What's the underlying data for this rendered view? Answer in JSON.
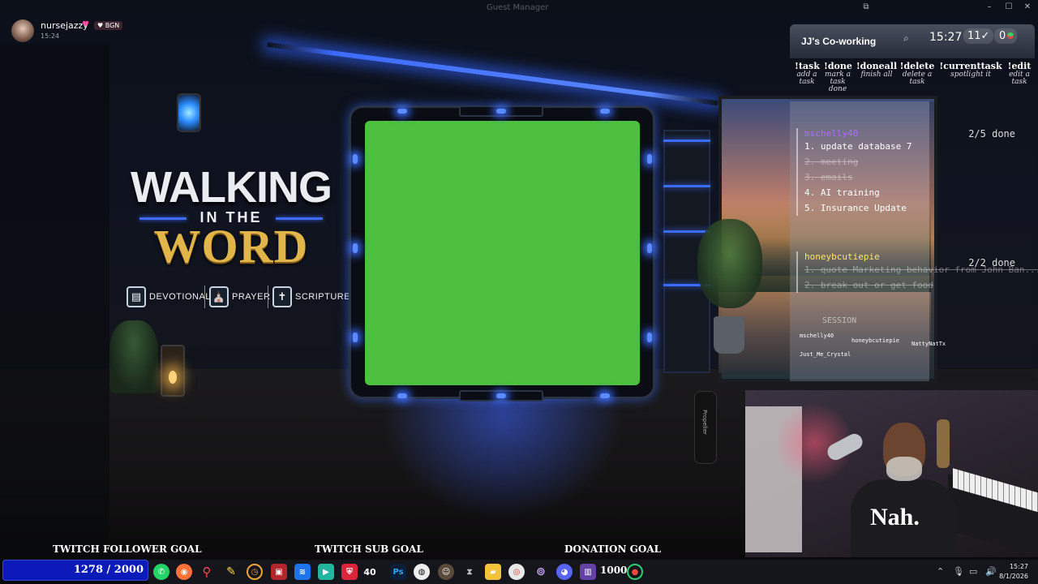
{
  "window": {
    "title": "Guest Manager"
  },
  "user": {
    "name": "nursejazzy",
    "time": "15:24",
    "badge": "BGN"
  },
  "logo": {
    "line1": "WALKING",
    "line2": "IN THE",
    "line3": "WORD",
    "items": [
      {
        "label": "DEVOTIONALS",
        "icon": "book-icon"
      },
      {
        "label": "PRAYER",
        "icon": "praying-hands-icon"
      },
      {
        "label": "SCRIPTURE",
        "icon": "bible-icon"
      }
    ]
  },
  "cowork": {
    "title": "JJ's Co-working",
    "clock": "15:27",
    "count": "11✓",
    "zero": "0",
    "commands": [
      {
        "name": "!task",
        "desc": "add a task"
      },
      {
        "name": "!done",
        "desc": "mark a task done"
      },
      {
        "name": "!doneall",
        "desc": "finish all"
      },
      {
        "name": "!delete",
        "desc": "delete a task"
      },
      {
        "name": "!currenttask",
        "desc": "spotlight it"
      },
      {
        "name": "!edit",
        "desc": "edit a task"
      }
    ],
    "users": [
      {
        "name": "mschelly40",
        "progress": "2/5 done",
        "tasks": [
          {
            "text": "1. update database 7",
            "done": false
          },
          {
            "text": "2. meeting",
            "done": true
          },
          {
            "text": "3. emails",
            "done": true
          },
          {
            "text": "4. AI training",
            "done": false
          },
          {
            "text": "5. Insurance Update",
            "done": false
          }
        ]
      },
      {
        "name": "honeybcutiepie",
        "progress": "2/2 done",
        "tasks": [
          {
            "text": "1. quote Marketing behavior from John Ban...",
            "done": true
          },
          {
            "text": "2. break out or get food",
            "done": true
          }
        ]
      }
    ],
    "session_label": "SESSION",
    "session_names": [
      "mschelly40",
      "honeybcutiepie",
      "NattyNatTx",
      "Just_Me_Crystal"
    ]
  },
  "webcam": {
    "shirt_text": "Nah."
  },
  "scene": {
    "bottle_text": "Propeller"
  },
  "goals": {
    "follower_label": "TWITCH FOLLOWER GOAL",
    "follower_value": "1278 / 2000",
    "follower_fraction": 0.639,
    "sub_label": "TWITCH SUB GOAL",
    "sub_value": "40",
    "donation_label": "DONATION GOAL",
    "donation_value": "1000"
  },
  "taskbar": {
    "icons": [
      "whatsapp-icon",
      "firefox-icon",
      "search-icon",
      "pencil-icon",
      "clock-app-icon",
      "red-app-icon",
      "sky-app-icon",
      "video-app-icon",
      "shield-app-icon",
      "streaming-app-icon",
      "photoshop-icon",
      "obs-icon",
      "avatar-app-icon",
      "cut-app-icon",
      "files-icon",
      "chrome-icon",
      "fingerprint-icon",
      "discord-icon",
      "twitch-icon",
      "record-icon"
    ],
    "photoshop_label": "Ps",
    "clock_time": "15:27",
    "clock_date": "8/1/2026"
  },
  "colors": {
    "green_screen": "#4ec03f",
    "accent_blue": "#3b6cff",
    "logo_gold": "#e1b54a",
    "goal_bar": "#0b1ab8"
  }
}
